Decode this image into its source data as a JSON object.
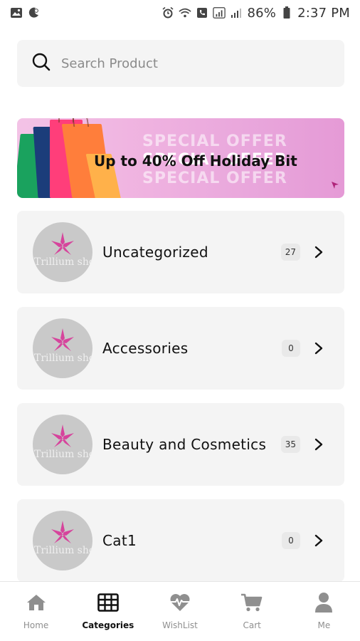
{
  "status_bar": {
    "battery": "86%",
    "time": "2:37 PM"
  },
  "search": {
    "placeholder": "Search Product"
  },
  "banner": {
    "title": "Up to 40% Off Holiday Bit",
    "ghost_text": "SPECIAL OFFER"
  },
  "categories": [
    {
      "name": "Uncategorized",
      "count": "27"
    },
    {
      "name": "Accessories",
      "count": "0"
    },
    {
      "name": "Beauty and Cosmetics",
      "count": "35"
    },
    {
      "name": "Cat1",
      "count": "0"
    }
  ],
  "avatar_brand": "Trillium shop",
  "bottom_nav": {
    "items": [
      {
        "label": "Home",
        "icon": "home-icon"
      },
      {
        "label": "Categories",
        "icon": "grid-icon"
      },
      {
        "label": "WishList",
        "icon": "heart-pulse-icon"
      },
      {
        "label": "Cart",
        "icon": "cart-icon"
      },
      {
        "label": "Me",
        "icon": "user-icon"
      }
    ],
    "active_index": 1
  },
  "colors": {
    "accent": "#d6449c",
    "card_bg": "#f4f4f4",
    "avatar_bg": "#c9c9c9"
  }
}
